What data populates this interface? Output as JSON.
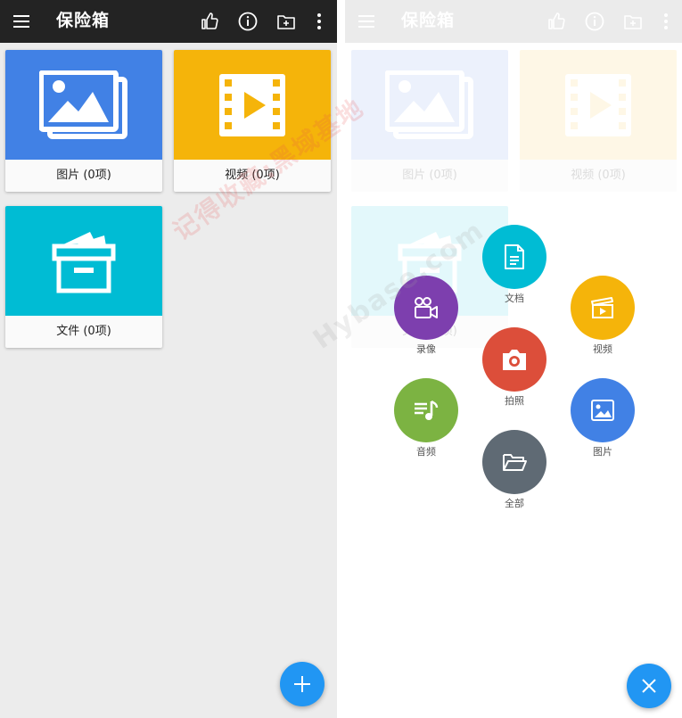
{
  "appbar": {
    "title": "保险箱",
    "icons": [
      "menu-icon",
      "thumbs-up-icon",
      "info-icon",
      "add-folder-icon",
      "more-vertical-icon"
    ]
  },
  "categories": [
    {
      "label": "图片 (0项)",
      "icon": "images-icon",
      "color": "#4181e5"
    },
    {
      "label": "视频 (0项)",
      "icon": "film-play-icon",
      "color": "#f5b40a"
    },
    {
      "label": "文件 (0项)",
      "icon": "archive-box-icon",
      "color": "#00bcd4"
    }
  ],
  "fab": {
    "left_icon": "plus-icon",
    "right_icon": "close-icon",
    "color": "#2196f3"
  },
  "menu": {
    "actions": [
      {
        "key": "docs",
        "label": "文档",
        "icon": "document-icon",
        "color": "#00bcd4"
      },
      {
        "key": "record",
        "label": "录像",
        "icon": "video-camera-icon",
        "color": "#7d3fae"
      },
      {
        "key": "video",
        "label": "视频",
        "icon": "clapperboard-icon",
        "color": "#f5b40a"
      },
      {
        "key": "photo",
        "label": "拍照",
        "icon": "camera-icon",
        "color": "#dc4e3a"
      },
      {
        "key": "audio",
        "label": "音频",
        "icon": "music-note-icon",
        "color": "#7cb342"
      },
      {
        "key": "picture",
        "label": "图片",
        "icon": "image-icon",
        "color": "#4181e5"
      },
      {
        "key": "all",
        "label": "全部",
        "icon": "folder-open-icon",
        "color": "#5f6a74"
      }
    ]
  },
  "watermarks": [
    "记得收藏:黑域基地",
    "Hybase.com"
  ]
}
